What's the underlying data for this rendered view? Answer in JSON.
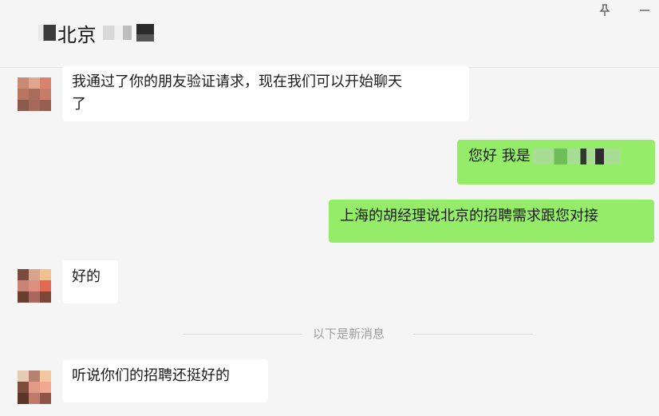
{
  "header": {
    "title": "北京",
    "pin_icon": "pin-icon",
    "minimize_icon": "minimize-icon"
  },
  "messages": [
    {
      "direction": "incoming",
      "text_line1": "我通过了你的朋友验证请求，现在我们可以开始聊天",
      "text_line2": "了"
    },
    {
      "direction": "outgoing",
      "text": "您好 我是"
    },
    {
      "direction": "outgoing",
      "text": "上海的胡经理说北京的招聘需求跟您对接"
    },
    {
      "direction": "incoming",
      "text": "好的"
    },
    {
      "direction": "incoming",
      "text": "听说你们的招聘还挺好的"
    }
  ],
  "divider": {
    "text": "以下是新消息"
  },
  "colors": {
    "outgoing_bubble": "#95ec69",
    "incoming_bubble": "#ffffff",
    "background": "#f5f5f5"
  }
}
